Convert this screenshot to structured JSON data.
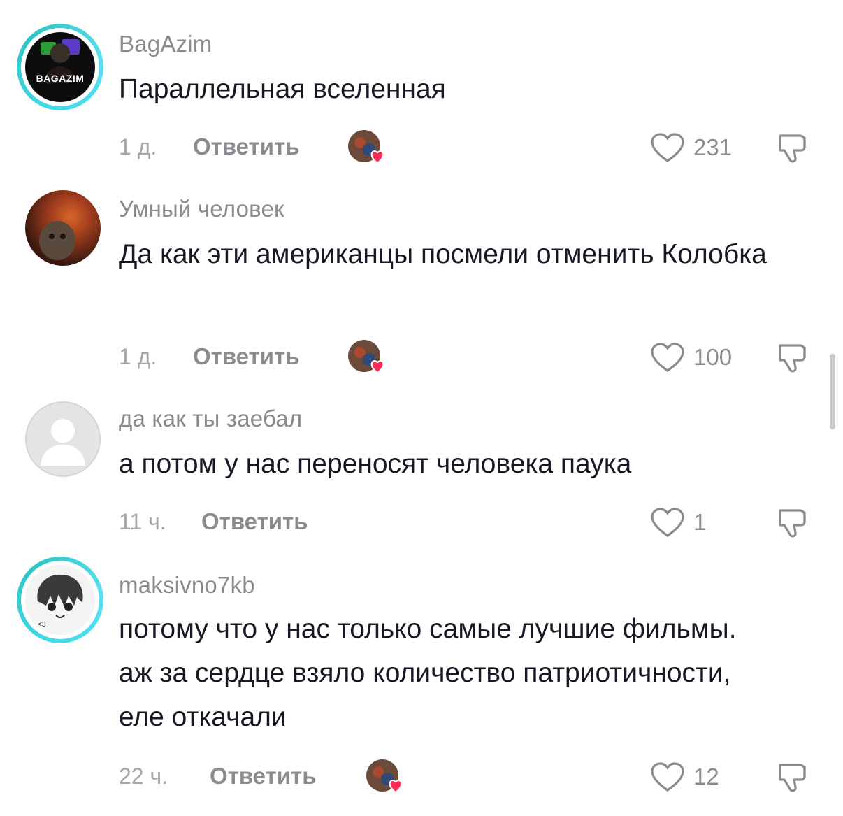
{
  "reply_label": "Ответить",
  "comments": [
    {
      "username": "BagAzim",
      "avatar_label": "BAGAZIM",
      "text": "Параллельная вселенная",
      "time": "1 д.",
      "likes": "231",
      "liked_by_creator": true
    },
    {
      "username": "Умный человек",
      "text": "Да как эти американцы посмели отменить Колобка",
      "time": "1 д.",
      "likes": "100",
      "liked_by_creator": true
    },
    {
      "username": "да как ты заебал",
      "text": "а потом у нас переносят человека паука",
      "time": "11 ч.",
      "likes": "1",
      "liked_by_creator": false
    },
    {
      "username": "maksivno7kb",
      "avatar_label": "<3",
      "text": "потому что у нас только самые лучшие фильмы. аж за сердце взяло количество патриотичности, еле откачали",
      "time": "22 ч.",
      "likes": "12",
      "liked_by_creator": true
    }
  ],
  "icons": {
    "like": "heart-outline-icon",
    "dislike": "thumbs-down-icon",
    "creator_like": "creator-liked-heart-icon"
  },
  "colors": {
    "username": "#8a8a8f",
    "text": "#161823",
    "story_ring": "#3fd9e8",
    "creator_heart": "#fe2c55"
  }
}
